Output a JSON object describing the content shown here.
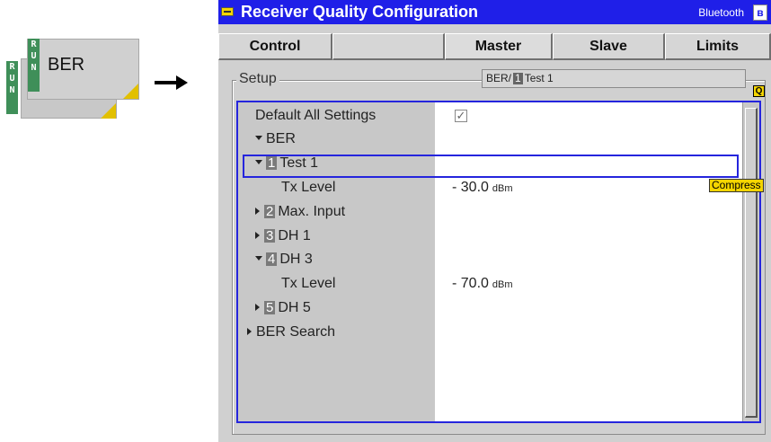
{
  "softkey": {
    "run_letters": [
      "R",
      "U",
      "N"
    ],
    "label": "BER",
    "back_label_fragment": "B"
  },
  "window": {
    "title": "Receiver Quality Configuration",
    "right_label": "Bluetooth",
    "right_icon": "bluetooth-icon"
  },
  "tabs": [
    {
      "label": "Control"
    },
    {
      "label": ""
    },
    {
      "label": "Master"
    },
    {
      "label": "Slave"
    },
    {
      "label": "Limits"
    }
  ],
  "setup": {
    "legend": "Setup",
    "path_prefix": "BER/",
    "path_index": "1",
    "path_name": "Test 1",
    "q_badge": "Q",
    "compress_badge": "Compress"
  },
  "rows": {
    "default_all": {
      "label": "Default All Settings",
      "checked": true,
      "check_glyph": "✓"
    },
    "ber": {
      "label": "BER"
    },
    "test1": {
      "index": "1",
      "label": "Test 1"
    },
    "test1_txlevel": {
      "label": "Tx Level",
      "value": "- 30.0",
      "unit": "dBm"
    },
    "maxinput": {
      "index": "2",
      "label": "Max. Input"
    },
    "dh1": {
      "index": "3",
      "label": "DH 1"
    },
    "dh3": {
      "index": "4",
      "label": "DH 3"
    },
    "dh3_txlevel": {
      "label": "Tx Level",
      "value": "- 70.0",
      "unit": "dBm"
    },
    "dh5": {
      "index": "5",
      "label": "DH 5"
    },
    "ber_search": {
      "label": "BER Search"
    }
  },
  "colors": {
    "title_bar": "#1f1fe8",
    "run_green": "#3f8f59",
    "accent_yellow": "#f4d500",
    "focus_blue": "#2525dd"
  }
}
